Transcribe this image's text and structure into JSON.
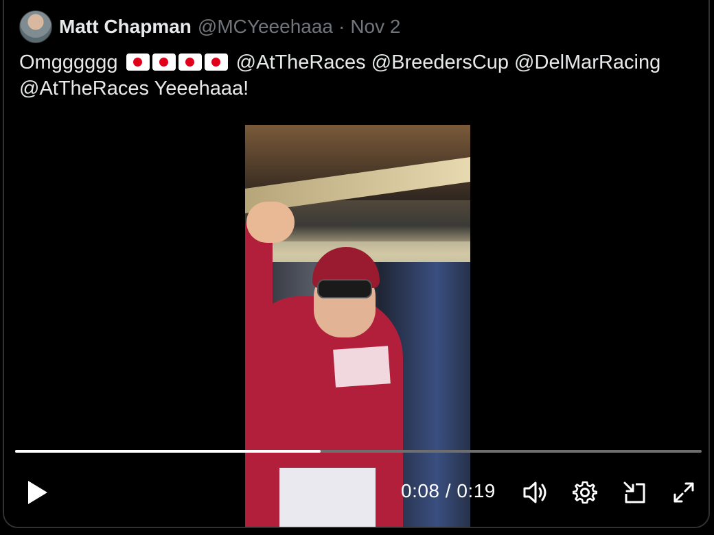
{
  "tweet": {
    "author_name": "Matt Chapman",
    "handle": "@MCYeeehaaa",
    "separator": "·",
    "date": "Nov 2",
    "text_start": "Omgggggg",
    "flag_icons": [
      "japan-flag-icon",
      "japan-flag-icon",
      "japan-flag-icon",
      "japan-flag-icon"
    ],
    "text_mentions": "@AtTheRaces @BreedersCup @DelMarRacing",
    "text_line2": "@AtTheRaces Yeeehaaa!"
  },
  "video": {
    "current_time": "0:08",
    "time_separator": "/",
    "duration": "0:19",
    "progress_fraction": 0.445,
    "icons": {
      "play": "play-icon",
      "volume": "volume-icon",
      "settings": "gear-icon",
      "pip": "picture-in-picture-icon",
      "fullscreen": "fullscreen-icon"
    }
  },
  "colors": {
    "background": "#000000",
    "text_primary": "#e7e9ea",
    "text_secondary": "#71767b",
    "jockey_silks": "#b21f3a",
    "progress_track": "#6e6e6e",
    "progress_fill": "#ffffff"
  }
}
